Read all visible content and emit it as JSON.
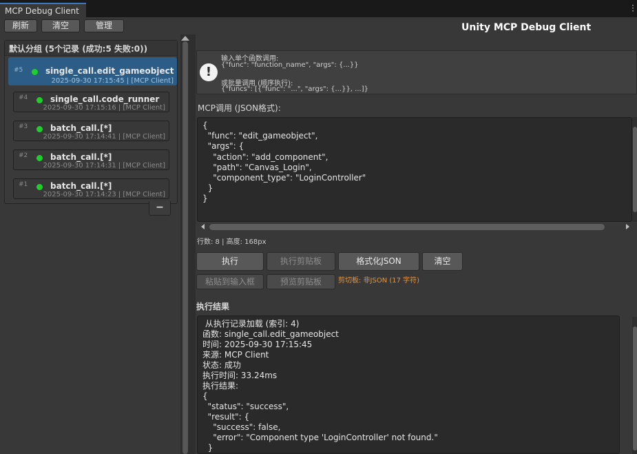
{
  "window": {
    "tab_title": "MCP Debug Client",
    "app_title": "Unity MCP Debug Client"
  },
  "toolbar": {
    "refresh_label": "刷新",
    "clear_label": "清空",
    "manage_label": "管理"
  },
  "group": {
    "title": "默认分组 (5个记录 (成功:5 失败:0))",
    "records": [
      {
        "index": "#5",
        "name": "single_call.edit_gameobject",
        "meta": "2025-09-30 17:15:45 | [MCP Client]",
        "status": "success",
        "selected": true
      },
      {
        "index": "#4",
        "name": "single_call.code_runner",
        "meta": "2025-09-30 17:15:16 | [MCP Client]",
        "status": "success",
        "selected": false
      },
      {
        "index": "#3",
        "name": "batch_call.[*]",
        "meta": "2025-09-30 17:14:41 | [MCP Client]",
        "status": "success",
        "selected": false
      },
      {
        "index": "#2",
        "name": "batch_call.[*]",
        "meta": "2025-09-30 17:14:31 | [MCP Client]",
        "status": "success",
        "selected": false
      },
      {
        "index": "#1",
        "name": "batch_call.[*]",
        "meta": "2025-09-30 17:14:23 | [MCP Client]",
        "status": "success",
        "selected": false
      }
    ],
    "remove_label": "−"
  },
  "help": {
    "line1": "输入单个函数调用:",
    "line2": "{\"func\": \"function_name\", \"args\": {...}}",
    "line3": "或批量调用 (顺序执行):",
    "line4": "{\"funcs\": [{\"func\": \"...\", \"args\": {...}}, ...]}",
    "icon": "!"
  },
  "input": {
    "label": "MCP调用 (JSON格式):",
    "lines": [
      "{",
      "  \"func\": \"edit_gameobject\",",
      "  \"args\": {",
      "    \"action\": \"add_component\",",
      "    \"path\": \"Canvas_Login\",",
      "    \"component_type\": \"LoginController\"",
      "  }",
      "}"
    ],
    "stats": "行数: 8 | 高度: 168px"
  },
  "actions": {
    "execute": "执行",
    "execute_clipboard": "执行剪贴板",
    "format_json": "格式化JSON",
    "clear": "清空",
    "paste_to_input": "粘贴到输入框",
    "preview_clipboard": "预览剪贴板",
    "clipboard_status": "剪切板: 非JSON (17 字符)"
  },
  "result": {
    "label": "执行结果",
    "lines": [
      " 从执行记录加载 (索引: 4)",
      "函数: single_call.edit_gameobject",
      "时间: 2025-09-30 17:15:45",
      "来源: MCP Client",
      "状态: 成功",
      "执行时间: 33.24ms",
      "执行结果:",
      "{",
      "  \"status\": \"success\",",
      "  \"result\": {",
      "    \"success\": false,",
      "    \"error\": \"Component type 'LoginController' not found.\"",
      "  }"
    ]
  },
  "colors": {
    "accent": "#3a79bb",
    "selected_row": "#2c5d87",
    "success_dot": "#1fce2b",
    "warning_text": "#e8953a"
  }
}
